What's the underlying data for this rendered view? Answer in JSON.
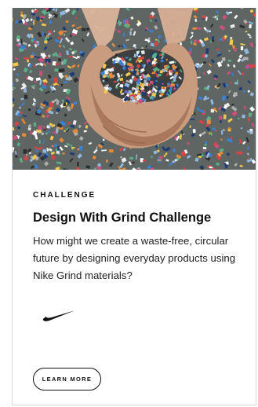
{
  "card": {
    "eyebrow": "CHALLENGE",
    "title": "Design With Grind Challenge",
    "description": "How might we create a waste-free, circular future by designing everyday products using Nike Grind materials?",
    "cta_label": "LEARN MORE"
  },
  "hero": {
    "icon": "hands-holding-grind-material-photo"
  },
  "brand": {
    "logo_icon": "nike-swoosh-icon",
    "logo_color": "#111111"
  }
}
